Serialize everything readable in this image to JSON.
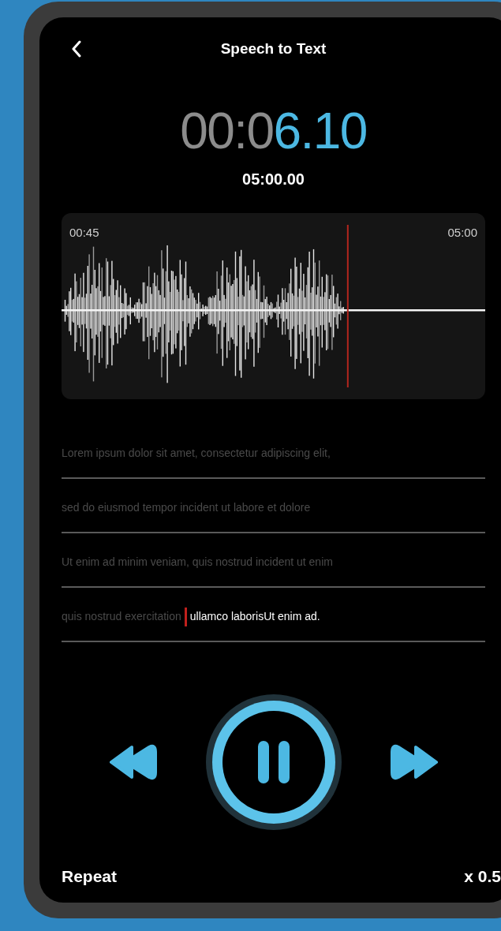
{
  "header": {
    "title": "Speech to Text"
  },
  "timer": {
    "elapsed_dim": "00:0",
    "elapsed_bright": "6.10",
    "total": "05:00.00"
  },
  "waveform": {
    "start_label": "00:45",
    "end_label": "05:00",
    "level": 0.67
  },
  "transcript": [
    {
      "segments": [
        {
          "text": "Lorem ipsum dolor sit amet, consectetur adipiscing elit,",
          "current": false
        }
      ]
    },
    {
      "segments": [
        {
          "text": "sed do eiusmod tempor  incident ut labore et dolore",
          "current": false
        }
      ]
    },
    {
      "segments": [
        {
          "text": "Ut enim ad minim veniam, quis nostrud incident ut enim",
          "current": false
        }
      ]
    },
    {
      "segments": [
        {
          "text": "quis nostrud exercitation",
          "current": false
        },
        {
          "text": "ullamco laborisUt enim ad.",
          "current": true
        }
      ]
    }
  ],
  "player": {
    "playing": true
  },
  "footer": {
    "repeat": "Repeat",
    "speed": "x 0.5"
  }
}
